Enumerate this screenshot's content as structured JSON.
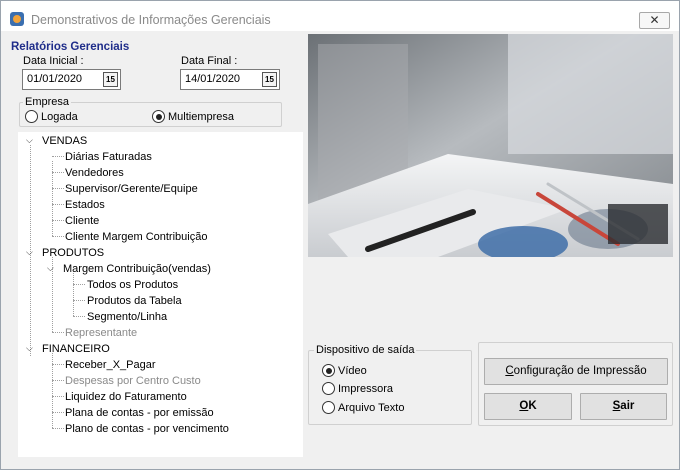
{
  "window": {
    "title": "Demonstrativos de Informações Gerenciais"
  },
  "filters": {
    "section_title": "Relatórios Gerenciais",
    "data_inicial_label": "Data Inicial :",
    "data_inicial_value": "01/01/2020",
    "data_final_label": "Data Final :",
    "data_final_value": "14/01/2020",
    "calendar_glyph": "15"
  },
  "empresa": {
    "caption": "Empresa",
    "options": [
      {
        "label": "Logada",
        "checked": false
      },
      {
        "label": "Multiempresa",
        "checked": true
      }
    ]
  },
  "tree": {
    "vendas": {
      "label": "VENDAS",
      "children": [
        {
          "label": "Diárias Faturadas",
          "enabled": true
        },
        {
          "label": "Vendedores",
          "enabled": true
        },
        {
          "label": "Supervisor/Gerente/Equipe",
          "enabled": true
        },
        {
          "label": "Estados",
          "enabled": true
        },
        {
          "label": "Cliente",
          "enabled": true
        },
        {
          "label": "Cliente Margem Contribuição",
          "enabled": true
        }
      ]
    },
    "produtos": {
      "label": "PRODUTOS",
      "margem": {
        "label": "Margem Contribuição(vendas)",
        "children": [
          {
            "label": "Todos os Produtos",
            "enabled": true
          },
          {
            "label": "Produtos da Tabela",
            "enabled": true
          },
          {
            "label": "Segmento/Linha",
            "enabled": true
          }
        ]
      },
      "representante": {
        "label": "Representante",
        "enabled": false
      }
    },
    "financeiro": {
      "label": "FINANCEIRO",
      "children": [
        {
          "label": "Receber_X_Pagar",
          "enabled": true
        },
        {
          "label": "Despesas por Centro Custo",
          "enabled": false
        },
        {
          "label": "Liquidez do Faturamento",
          "enabled": true
        },
        {
          "label": "Plana de contas - por emissão",
          "enabled": true
        },
        {
          "label": "Plano de contas - por vencimento",
          "enabled": true
        }
      ]
    }
  },
  "output": {
    "caption": "Dispositivo de saída",
    "options": [
      {
        "label": "Vídeo",
        "checked": true
      },
      {
        "label": "Impressora",
        "checked": false
      },
      {
        "label": "Arquivo Texto",
        "checked": false
      }
    ]
  },
  "buttons": {
    "config_prefix": "C",
    "config_rest": "onfiguração de Impressão",
    "ok_u": "O",
    "ok_rest": "K",
    "sair_u": "S",
    "sair_rest": "air"
  },
  "colors": {
    "section_title": "#1f2d8a",
    "accent_icon": "#3b6fb0"
  },
  "icons": [
    "app-icon",
    "close-icon",
    "calendar-icon",
    "expand-caret-icon"
  ]
}
